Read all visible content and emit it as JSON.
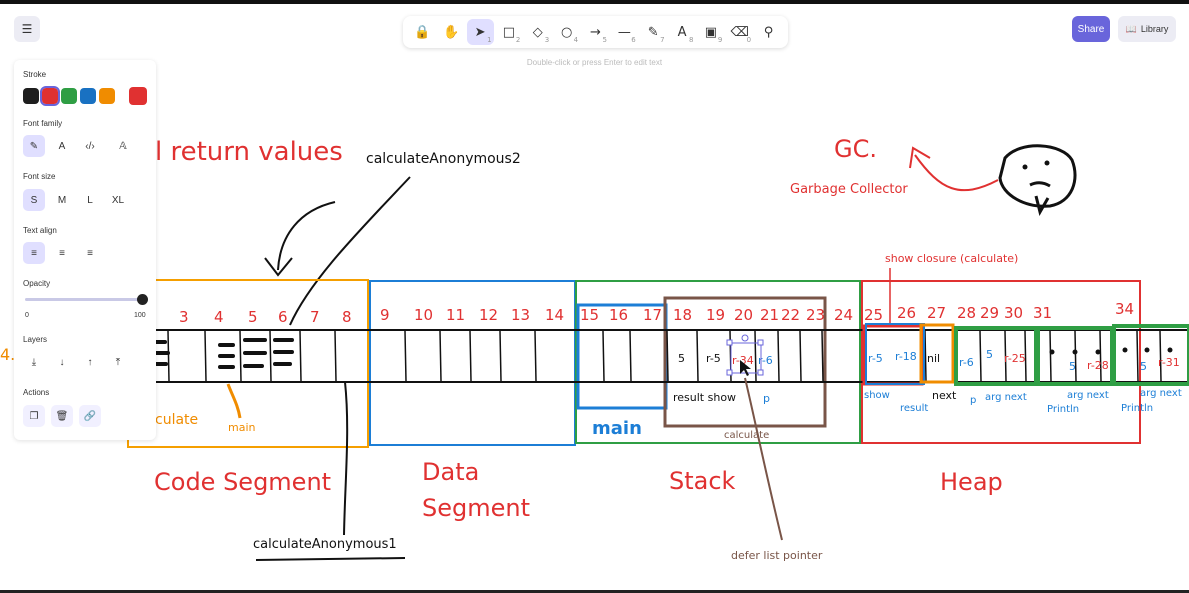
{
  "toolbar": {
    "hint": "Double-click or press Enter to edit text",
    "tools": [
      {
        "icon": "lock-icon",
        "glyph": "🔒",
        "num": ""
      },
      {
        "icon": "hand-icon",
        "glyph": "✋",
        "num": ""
      },
      {
        "icon": "selection-icon",
        "glyph": "➤",
        "num": "1"
      },
      {
        "icon": "rectangle-icon",
        "glyph": "□",
        "num": "2"
      },
      {
        "icon": "diamond-icon",
        "glyph": "◇",
        "num": "3"
      },
      {
        "icon": "ellipse-icon",
        "glyph": "○",
        "num": "4"
      },
      {
        "icon": "arrow-icon",
        "glyph": "→",
        "num": "5"
      },
      {
        "icon": "line-icon",
        "glyph": "—",
        "num": "6"
      },
      {
        "icon": "draw-icon",
        "glyph": "✎",
        "num": "7"
      },
      {
        "icon": "text-icon",
        "glyph": "A",
        "num": "8"
      },
      {
        "icon": "image-icon",
        "glyph": "▣",
        "num": "9"
      },
      {
        "icon": "eraser-icon",
        "glyph": "⌫",
        "num": "0"
      },
      {
        "icon": "more-tools-icon",
        "glyph": "⚲",
        "num": ""
      }
    ]
  },
  "header": {
    "share_label": "Share",
    "library_label": "Library"
  },
  "panel": {
    "stroke_label": "Stroke",
    "stroke_colors": [
      "#1e1e1e",
      "#e03131",
      "#2f9e44",
      "#1971c2",
      "#f08c00"
    ],
    "stroke_current": "#e03131",
    "font_family_label": "Font family",
    "font_size_label": "Font size",
    "font_sizes": [
      "S",
      "M",
      "L",
      "XL"
    ],
    "text_align_label": "Text align",
    "opacity_label": "Opacity",
    "opacity_min": "0",
    "opacity_max": "100",
    "opacity_value": 100,
    "layers_label": "Layers",
    "actions_label": "Actions"
  },
  "canvas": {
    "title_fragment": "l return values",
    "calc_anon2": "calculateAnonymous2",
    "calc_anon1": "calculateAnonymous1",
    "gc": "GC.",
    "garbage_collector": "Garbage Collector",
    "show_closure": "show closure (calculate)",
    "defer_list_pointer": "defer list pointer",
    "left_edge_number": "4.",
    "code_numbers": [
      "3",
      "4",
      "5",
      "6",
      "7",
      "8"
    ],
    "data_numbers": [
      "9",
      "10",
      "11",
      "12",
      "13",
      "14"
    ],
    "stack_numbers": [
      "15",
      "16",
      "17",
      "18",
      "19",
      "20",
      "21",
      "22",
      "23",
      "24"
    ],
    "heap_numbers": [
      "25",
      "26",
      "27",
      "28",
      "29",
      "30",
      "31",
      "34"
    ],
    "stack_cells": [
      "5",
      "r-5",
      "r-34",
      "r-6"
    ],
    "heap_cells": [
      "r-5",
      "r-18",
      "nil",
      "r-6",
      "5",
      "r-25",
      "5",
      "r-28",
      "5",
      "r-31"
    ],
    "labels": {
      "calculate_frag": "culate",
      "main_code": "main",
      "main_stack": "main",
      "result_show": "result show",
      "p_stack": "p",
      "calculate_stack": "calculate",
      "heap_show": "show",
      "heap_result": "result",
      "heap_next1": "next",
      "heap_p": "p",
      "heap_arg_next1": "arg next",
      "heap_arg_next2": "arg next",
      "heap_arg_next3": "arg next",
      "heap_println1": "Println",
      "heap_println2": "Println"
    },
    "segments": {
      "code": "Code Segment",
      "data_line1": "Data",
      "data_line2": "Segment",
      "stack": "Stack",
      "heap": "Heap"
    }
  }
}
